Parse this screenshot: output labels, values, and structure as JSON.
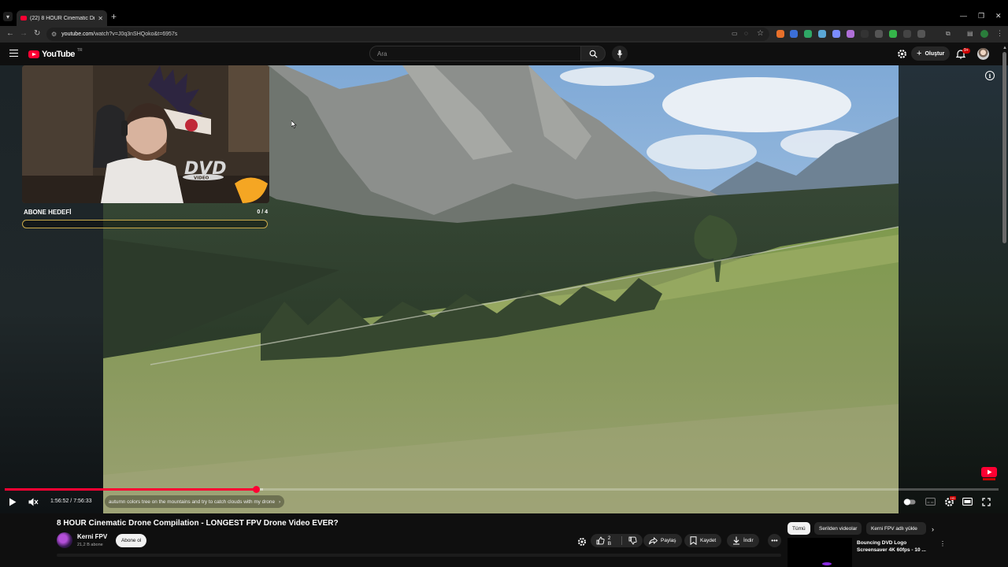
{
  "browser": {
    "tab_title": "(22) 8 HOUR Cinematic Drone ...",
    "url_host": "youtube.com",
    "url_path": "/watch?v=J0q3nSHQoko&t=6957s"
  },
  "masthead": {
    "logo_text": "YouTube",
    "country_code": "TR",
    "search_placeholder": "Ara",
    "create_label": "Oluştur",
    "notification_count": "9+"
  },
  "overlay": {
    "goal_title": "ABONE HEDEFİ",
    "goal_count": "0 / 4",
    "goal_progress": 0,
    "dvd_logo_text": "DVD",
    "dvd_logo_sub": "VIDEO"
  },
  "player": {
    "current_time": "1:56:52",
    "duration": "7:56:33",
    "time_display": "1:56:52 / 7:56:33",
    "chapter_title": "autumn colors tree on the mountains and try to catch clouds with my drone",
    "played_fraction": 0.2526,
    "buffered_fraction": 0.26
  },
  "video": {
    "title": "8 HOUR Cinematic Drone Compilation - LONGEST FPV Drone Video EVER?",
    "channel_name": "Kerni FPV",
    "subscribers": "21,2 B abone",
    "subscribe_label": "Abone ol",
    "likes": "2 B",
    "share_label": "Paylaş",
    "save_label": "Kaydet",
    "download_label": "İndir"
  },
  "recommendations": {
    "chips": [
      "Tümü",
      "Serilden videolar",
      "Kerni FPV adlı yükle"
    ],
    "items": [
      {
        "title": "Bouncing DVD Logo Screensaver 4K 60fps - 10 ..."
      }
    ]
  },
  "colors": {
    "accent": "#ff0033",
    "goal_border": "#c9a94a",
    "background": "#0f0f0f"
  }
}
